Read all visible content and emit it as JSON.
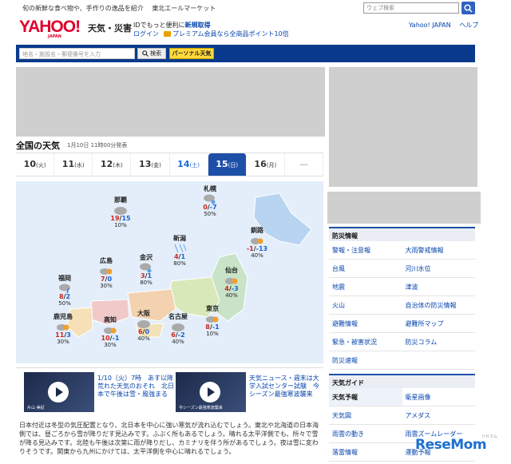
{
  "header": {
    "promo": [
      "旬の新鮮な食べ物や、手作りの逸品を紹介",
      "東北エールマーケット"
    ],
    "web_search_placeholder": "ウェブ検索",
    "logo_text": "YAHOO!",
    "logo_sub": "JAPAN",
    "service_title": "天気・災害",
    "login_note_prefix": "IDでもっと便利に",
    "login_note_link": "新規取得",
    "login_label": "ログイン",
    "premium_link": "プレミアム会員なら全商品ポイント10倍",
    "links": [
      "Yahoo! JAPAN",
      "ヘルプ"
    ]
  },
  "searchbar": {
    "placeholder": "地名・施設名・郵便番号を入力",
    "search_label": "検索",
    "personal_label": "パーソナル天気"
  },
  "section": {
    "title": "全国の天気",
    "announced": "1月10日 11時00分発表"
  },
  "tabs": [
    {
      "day": "10",
      "dow": "(火)"
    },
    {
      "day": "11",
      "dow": "(水)"
    },
    {
      "day": "12",
      "dow": "(木)"
    },
    {
      "day": "13",
      "dow": "(金)"
    },
    {
      "day": "14",
      "dow": "(土)"
    },
    {
      "day": "15",
      "dow": "(日)"
    },
    {
      "day": "16",
      "dow": "(月)"
    },
    {
      "day": "—",
      "dow": ""
    }
  ],
  "cities": [
    {
      "name": "那覇",
      "hi": "19",
      "lo": "15",
      "pop": "10%",
      "icon": "cloud-icon"
    },
    {
      "name": "札幌",
      "hi": "0",
      "lo": "-7",
      "pop": "50%",
      "icon": "cloud-snow-icon"
    },
    {
      "name": "釧路",
      "hi": "-1",
      "lo": "-13",
      "pop": "40%",
      "icon": "cloud-sun-icon"
    },
    {
      "name": "新潟",
      "hi": "4",
      "lo": "1",
      "pop": "80%",
      "icon": "snow-icon"
    },
    {
      "name": "金沢",
      "hi": "3",
      "lo": "1",
      "pop": "80%",
      "icon": "cloud-snow-icon"
    },
    {
      "name": "広島",
      "hi": "7",
      "lo": "0",
      "pop": "30%",
      "icon": "cloud-sun-icon"
    },
    {
      "name": "仙台",
      "hi": "4",
      "lo": "-3",
      "pop": "40%",
      "icon": "cloud-sun-icon"
    },
    {
      "name": "福岡",
      "hi": "8",
      "lo": "2",
      "pop": "50%",
      "icon": "cloud-rain-icon"
    },
    {
      "name": "鹿児島",
      "hi": "11",
      "lo": "3",
      "pop": "30%",
      "icon": "cloud-sun-icon"
    },
    {
      "name": "高知",
      "hi": "10",
      "lo": "-1",
      "pop": "30%",
      "icon": "cloud-sun-icon"
    },
    {
      "name": "大阪",
      "hi": "6",
      "lo": "0",
      "pop": "40%",
      "icon": "cloud-icon"
    },
    {
      "name": "名古屋",
      "hi": "6",
      "lo": "-2",
      "pop": "40%",
      "icon": "cloud-icon"
    },
    {
      "name": "東京",
      "hi": "8",
      "lo": "-1",
      "pop": "10%",
      "icon": "cloud-sun-icon"
    }
  ],
  "news": [
    {
      "text": "1/10（火）7時　あす以降荒れた天気のおそれ　北日本で午後は雪・風強まる",
      "caption": "片山 美紀"
    },
    {
      "text": "天気ニュース・週末は大学入試センター試験　今シーズン最強寒波襲来",
      "caption": "今シーズン最強寒波襲来"
    }
  ],
  "summary": "日本付近は冬型の気圧配置となり、北日本を中心に強い寒気が流れ込むでしょう。東北や北海道の日本海側では、昼ごろから雪が降りだす見込みです。ふぶく所もあるでしょう。晴れる太平洋側でも、所々で雪が降る見込みです。北陸も午後は次第に雨が降りだし、カミナリを伴う所があるでしょう。夜は雪に変わりそうです。関東から九州にかけては、太平洋側を中心に晴れるでしょう。",
  "sidebar": {
    "disaster_title": "防災情報",
    "disaster_items": [
      "警報・注意報",
      "大雨警戒情報",
      "台風",
      "河川水位",
      "地震",
      "津波",
      "火山",
      "自治体の防災情報",
      "避難情報",
      "避難所マップ",
      "緊急・被害状況",
      "防災コラム",
      "防災速報",
      ""
    ],
    "guide_title": "天気ガイド",
    "guide_items": [
      "天気予報",
      "衛星画像",
      "天気図",
      "アメダス",
      "雨雲の動き",
      "雨雲ズームレーダー",
      "落雷情報",
      "運動予報"
    ]
  },
  "watermark": {
    "text": "ReseMom",
    "sub": "リセマム"
  }
}
